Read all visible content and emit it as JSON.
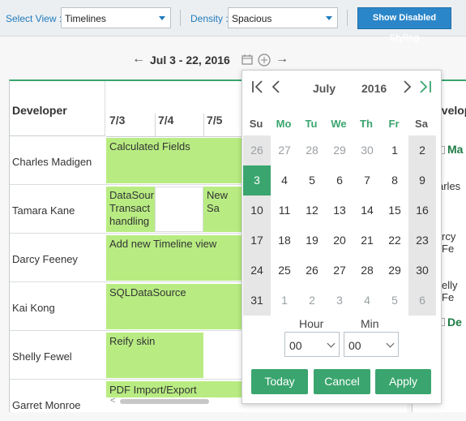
{
  "toolbar": {
    "select_view_label": "Select View :",
    "select_view_value": "Timelines",
    "density_label": "Density :",
    "density_value": "Spacious",
    "disabled_button": "Show Disabled Styling"
  },
  "navigation": {
    "prev_arrow": "←",
    "next_arrow": "→",
    "range": "Jul 3 - 22, 2016",
    "calendar_icon": "calendar-icon",
    "add_icon": "add-circle-icon"
  },
  "grid": {
    "header": "Developer",
    "dates": [
      "7/3",
      "7/4",
      "7/5"
    ],
    "rows": [
      {
        "name": "Charles Madigen",
        "event": "Calculated Fields"
      },
      {
        "name": "Tamara Kane",
        "event": "DataSour\nTransact\nhandling",
        "event2": "New Sa"
      },
      {
        "name": "Darcy Feeney",
        "event": "Add new Timeline view"
      },
      {
        "name": "Kai Kong",
        "event": "SQLDataSource"
      },
      {
        "name": "Shelly Fewel",
        "event": "Reify skin"
      },
      {
        "name": "Garret Monroe",
        "event": "PDF Import/Export"
      }
    ]
  },
  "right_panel": {
    "header": "evelop",
    "items": [
      "Ma",
      "arles",
      "rcy Fe",
      "elly Fe",
      "De"
    ]
  },
  "datepicker": {
    "first_icon": "first-page-icon",
    "prev_icon": "prev-icon",
    "next_icon": "next-icon",
    "last_icon": "last-page-icon",
    "month": "July",
    "year": "2016",
    "day_names": [
      "Su",
      "Mo",
      "Tu",
      "We",
      "Th",
      "Fr",
      "Sa"
    ],
    "weeks": [
      [
        "26",
        "27",
        "28",
        "29",
        "30",
        "1",
        "2"
      ],
      [
        "3",
        "4",
        "5",
        "6",
        "7",
        "8",
        "9"
      ],
      [
        "10",
        "11",
        "12",
        "13",
        "14",
        "15",
        "16"
      ],
      [
        "17",
        "18",
        "19",
        "20",
        "21",
        "22",
        "23"
      ],
      [
        "24",
        "25",
        "26",
        "27",
        "28",
        "29",
        "30"
      ],
      [
        "31",
        "1",
        "2",
        "3",
        "4",
        "5",
        "6"
      ]
    ],
    "selected_day": "3",
    "hour_label": "Hour",
    "min_label": "Min",
    "hour_value": "00",
    "min_value": "00",
    "today_button": "Today",
    "cancel_button": "Cancel",
    "apply_button": "Apply"
  },
  "colors": {
    "accent_green": "#3aa56e",
    "event_green": "#b8ec82",
    "button_blue": "#2b86c9"
  }
}
